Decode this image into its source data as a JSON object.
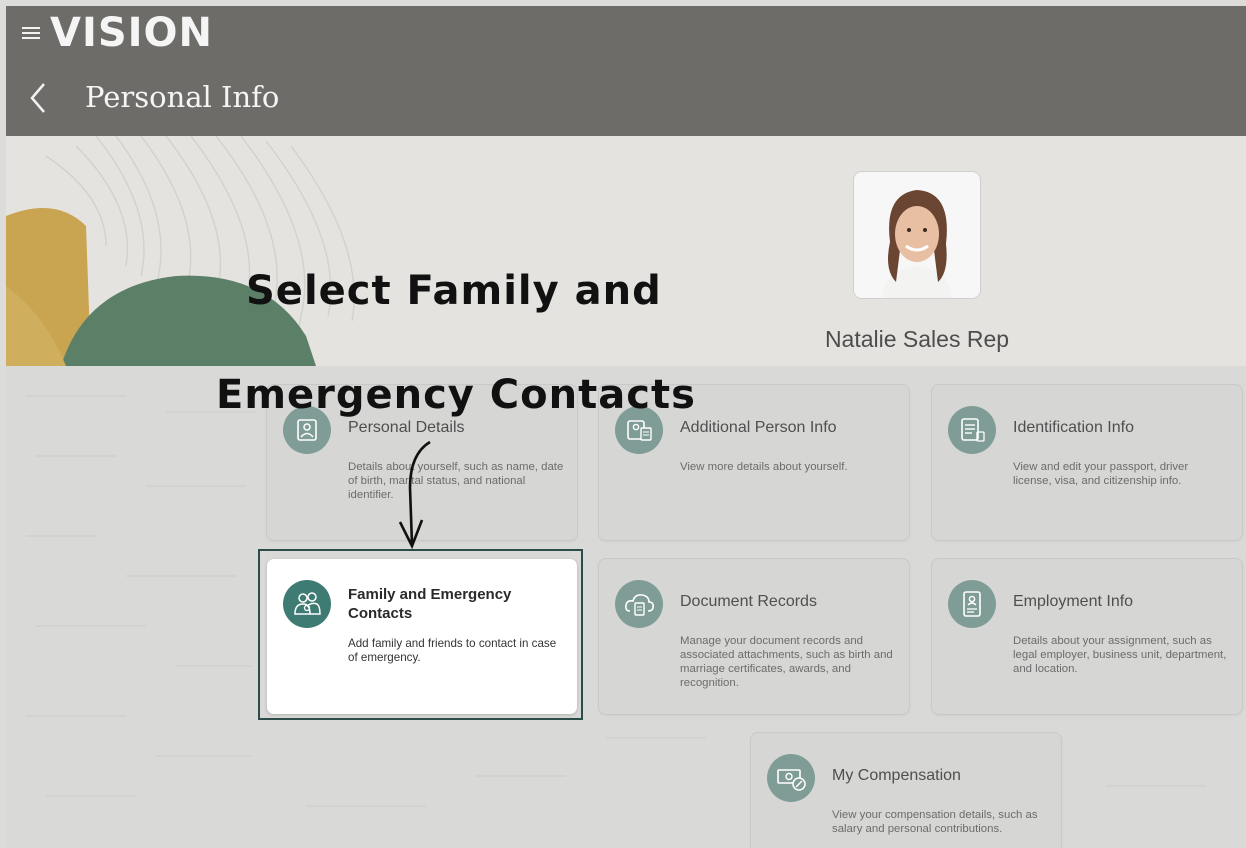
{
  "app": {
    "logo": "VISION",
    "page_title": "Personal Info"
  },
  "profile": {
    "name": "Natalie Sales Rep"
  },
  "annotation": {
    "line1": "Select Family and",
    "line2": "Emergency Contacts"
  },
  "cards": [
    {
      "title": "Personal Details",
      "description": "Details about yourself, such as name, date of birth, marital status, and national identifier.",
      "icon": "person-badge-icon",
      "selected": false
    },
    {
      "title": "Additional Person Info",
      "description": "View more details about yourself.",
      "icon": "person-clipboard-icon",
      "selected": false
    },
    {
      "title": "Identification Info",
      "description": "View and edit your passport, driver license, visa, and citizenship info.",
      "icon": "id-document-icon",
      "selected": false
    },
    {
      "title": "Family and Emergency Contacts",
      "description": "Add family and friends to contact in case of emergency.",
      "icon": "family-icon",
      "selected": true
    },
    {
      "title": "Document Records",
      "description": "Manage your document records and associated attachments, such as birth and marriage certificates, awards, and recognition.",
      "icon": "cloud-document-icon",
      "selected": false
    },
    {
      "title": "Employment Info",
      "description": "Details about your assignment, such as legal employer, business unit, department, and location.",
      "icon": "employee-badge-icon",
      "selected": false
    },
    {
      "title": "My Compensation",
      "description": "View your compensation details, such as salary and personal contributions.",
      "icon": "compensation-icon",
      "selected": false
    }
  ],
  "colors": {
    "header": "#6d6c69",
    "accent": "#3e7b72",
    "muted_icon": "#7f9d96",
    "highlight_border": "#2b4c48"
  }
}
